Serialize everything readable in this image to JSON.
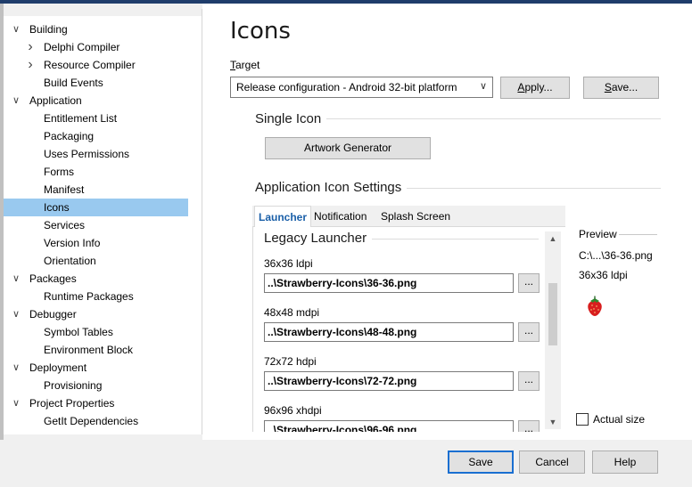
{
  "tree": [
    {
      "label": "Building",
      "level": 0,
      "expander": "down"
    },
    {
      "label": "Delphi Compiler",
      "level": 1,
      "expander": "right"
    },
    {
      "label": "Resource Compiler",
      "level": 1,
      "expander": "right"
    },
    {
      "label": "Build Events",
      "level": 1,
      "expander": ""
    },
    {
      "label": "Application",
      "level": 0,
      "expander": "down"
    },
    {
      "label": "Entitlement List",
      "level": 1,
      "expander": ""
    },
    {
      "label": "Packaging",
      "level": 1,
      "expander": ""
    },
    {
      "label": "Uses Permissions",
      "level": 1,
      "expander": ""
    },
    {
      "label": "Forms",
      "level": 1,
      "expander": ""
    },
    {
      "label": "Manifest",
      "level": 1,
      "expander": ""
    },
    {
      "label": "Icons",
      "level": 1,
      "expander": "",
      "selected": true
    },
    {
      "label": "Services",
      "level": 1,
      "expander": ""
    },
    {
      "label": "Version Info",
      "level": 1,
      "expander": ""
    },
    {
      "label": "Orientation",
      "level": 1,
      "expander": ""
    },
    {
      "label": "Packages",
      "level": 0,
      "expander": "down"
    },
    {
      "label": "Runtime Packages",
      "level": 1,
      "expander": ""
    },
    {
      "label": "Debugger",
      "level": 0,
      "expander": "down"
    },
    {
      "label": "Symbol Tables",
      "level": 1,
      "expander": ""
    },
    {
      "label": "Environment Block",
      "level": 1,
      "expander": ""
    },
    {
      "label": "Deployment",
      "level": 0,
      "expander": "down"
    },
    {
      "label": "Provisioning",
      "level": 1,
      "expander": ""
    },
    {
      "label": "Project Properties",
      "level": 0,
      "expander": "down"
    },
    {
      "label": "GetIt Dependencies",
      "level": 1,
      "expander": ""
    }
  ],
  "page": {
    "title": "Icons",
    "target_label": "Target",
    "target_value": "Release configuration - Android 32-bit platform",
    "apply_label": "Apply...",
    "save_label": "Save..."
  },
  "single_icon": {
    "title": "Single Icon",
    "artwork_button": "Artwork Generator"
  },
  "app_icon_settings": {
    "title": "Application Icon Settings",
    "tabs": [
      "Launcher",
      "Notification",
      "Splash Screen"
    ],
    "active_tab": "Launcher",
    "section_title": "Legacy Launcher",
    "browse_label": "...",
    "fields": [
      {
        "label": "36x36 ldpi",
        "value": "..\\Strawberry-Icons\\36-36.png"
      },
      {
        "label": "48x48 mdpi",
        "value": "..\\Strawberry-Icons\\48-48.png"
      },
      {
        "label": "72x72 hdpi",
        "value": "..\\Strawberry-Icons\\72-72.png"
      },
      {
        "label": "96x96 xhdpi",
        "value": "..\\Strawberry-Icons\\96-96.png"
      }
    ],
    "scroll_position": 0.35
  },
  "preview": {
    "title": "Preview",
    "path": "C:\\...\\36-36.png",
    "size": "36x36 ldpi",
    "icon": "strawberry-icon",
    "actual_size_label": "Actual size",
    "actual_size_checked": false
  },
  "footer": {
    "save": "Save",
    "cancel": "Cancel",
    "help": "Help"
  },
  "colors": {
    "selection": "#99c9ef",
    "accent": "#1a6fd1",
    "tab_active_text": "#1a5fa8"
  }
}
